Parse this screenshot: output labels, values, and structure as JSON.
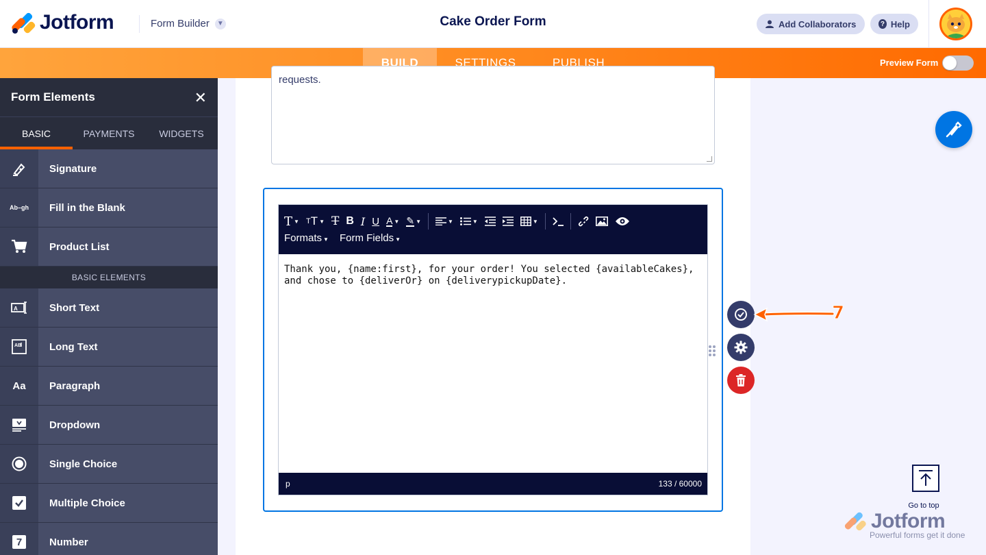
{
  "header": {
    "brand": "Jotform",
    "builder_label": "Form Builder",
    "form_title": "Cake Order Form",
    "add_collaborators": "Add Collaborators",
    "help": "Help"
  },
  "nav": {
    "tabs": [
      {
        "label": "BUILD",
        "active": true
      },
      {
        "label": "SETTINGS",
        "active": false
      },
      {
        "label": "PUBLISH",
        "active": false
      }
    ],
    "preview_label": "Preview Form",
    "preview_on": false
  },
  "sidebar": {
    "title": "Form Elements",
    "tabs": [
      "BASIC",
      "PAYMENTS",
      "WIDGETS"
    ],
    "top_items": [
      {
        "label": "Signature",
        "icon": "signature-icon"
      },
      {
        "label": "Fill in the Blank",
        "icon": "fill-blank-icon",
        "glyph": "Ab–gh"
      },
      {
        "label": "Product List",
        "icon": "cart-icon"
      }
    ],
    "section_label": "BASIC ELEMENTS",
    "items": [
      {
        "label": "Short Text",
        "icon": "short-text-icon"
      },
      {
        "label": "Long Text",
        "icon": "long-text-icon"
      },
      {
        "label": "Paragraph",
        "icon": "paragraph-icon",
        "glyph": "Aa"
      },
      {
        "label": "Dropdown",
        "icon": "dropdown-icon"
      },
      {
        "label": "Single Choice",
        "icon": "radio-icon"
      },
      {
        "label": "Multiple Choice",
        "icon": "checkbox-icon"
      },
      {
        "label": "Number",
        "icon": "number-icon",
        "glyph": "7"
      }
    ]
  },
  "canvas": {
    "prev_textarea_text": "requests.",
    "editor": {
      "formats_label": "Formats",
      "form_fields_label": "Form Fields",
      "content": "Thank you, {name:first}, for your order! You selected {availableCakes}, and chose to {deliverOr} on {deliverypickupDate}.",
      "status_tag": "p",
      "char_count": "133 / 60000"
    }
  },
  "annotation": {
    "number": "7",
    "color": "#ff6100"
  },
  "go_to_top": "Go to top",
  "watermark": {
    "brand": "Jotform",
    "tagline": "Powerful forms get it done"
  },
  "colors": {
    "accent": "#ff6100",
    "primary_blue": "#0075e3",
    "navy": "#0a1551",
    "danger": "#dc2626"
  }
}
